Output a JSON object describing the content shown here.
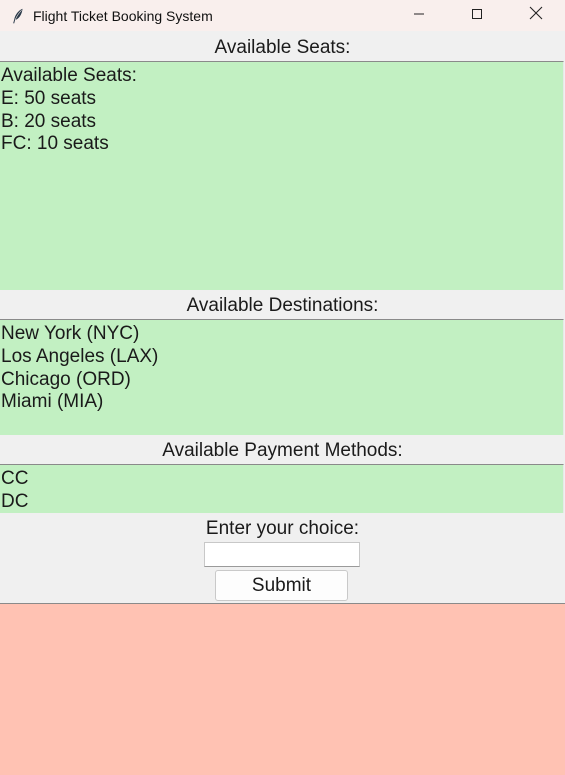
{
  "window": {
    "title": "Flight Ticket Booking System",
    "icon": "feather-icon",
    "controls": [
      "minimize-icon",
      "maximize-icon",
      "close-icon"
    ]
  },
  "seats": {
    "label": "Available Seats:",
    "lines": [
      "Available Seats:",
      "E: 50 seats",
      "B: 20 seats",
      "FC: 10 seats"
    ]
  },
  "destinations": {
    "label": "Available Destinations:",
    "lines": [
      "New York (NYC)",
      "Los Angeles (LAX)",
      "Chicago (ORD)",
      "Miami (MIA)"
    ]
  },
  "payment": {
    "label": "Available Payment Methods:",
    "lines": [
      "CC",
      "DC"
    ]
  },
  "choice": {
    "label": "Enter your choice:",
    "value": "",
    "submit_label": "Submit"
  },
  "output": {
    "text": ""
  },
  "colors": {
    "list_background": "#c2f0c2",
    "output_background": "#ffc2b3",
    "window_background": "#f0f0f0",
    "titlebar_background": "#f9efed"
  }
}
